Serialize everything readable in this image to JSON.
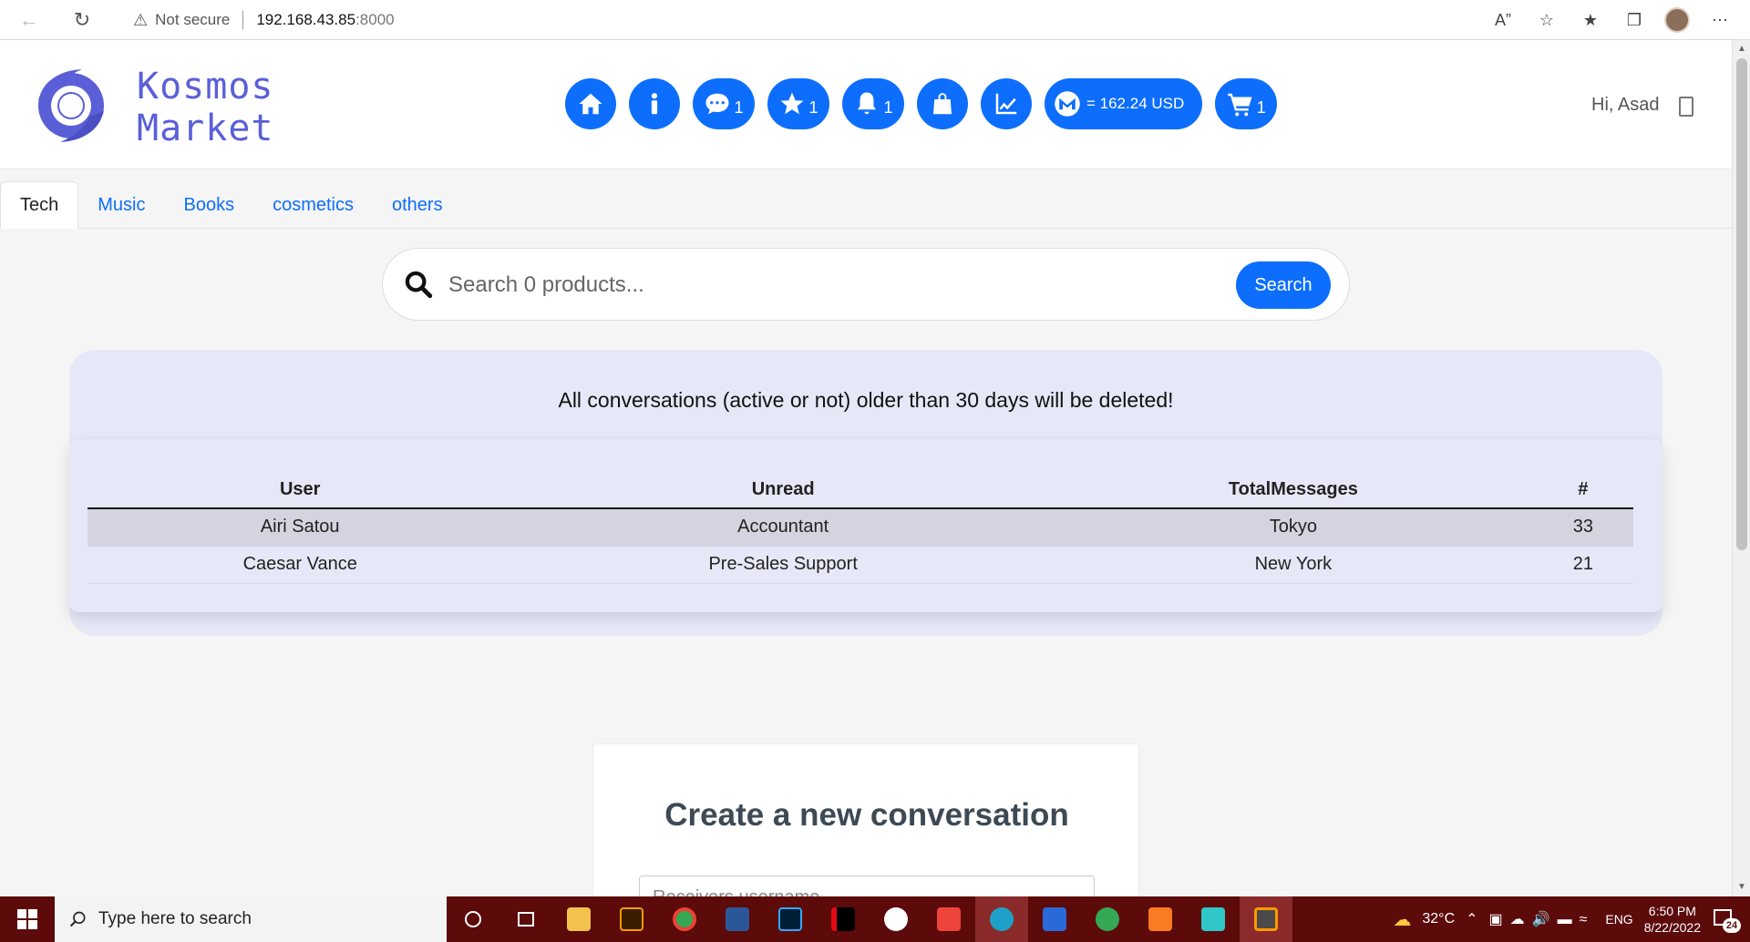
{
  "browser": {
    "security_label": "Not secure",
    "url_host": "192.168.43.85",
    "url_port": ":8000"
  },
  "header": {
    "brand_line1": "Kosmos",
    "brand_line2": "Market",
    "messages_count": "1",
    "favorites_count": "1",
    "notifications_count": "1",
    "balance": "= 162.24 USD",
    "cart_count": "1",
    "greeting": "Hi, Asad"
  },
  "tabs": [
    "Tech",
    "Music",
    "Books",
    "cosmetics",
    "others"
  ],
  "search": {
    "placeholder": "Search 0 products...",
    "button_label": "Search"
  },
  "conversations": {
    "notice": "All conversations (active or not) older than 30 days will be deleted!",
    "columns": [
      "User",
      "Unread",
      "TotalMessages",
      "#"
    ],
    "rows": [
      [
        "Airi Satou",
        "Accountant",
        "Tokyo",
        "33"
      ],
      [
        "Caesar Vance",
        "Pre-Sales Support",
        "New York",
        "21"
      ]
    ]
  },
  "create": {
    "title": "Create a new conversation",
    "receiver_placeholder": "Receivers username"
  },
  "taskbar": {
    "search_placeholder": "Type here to search",
    "temperature": "32°C",
    "language": "ENG",
    "time": "6:50 PM",
    "date": "8/22/2022",
    "notification_count": "24"
  },
  "colors": {
    "primary": "#0d6efd",
    "brand": "#5a5fd8",
    "card_bg": "#e6e8f7",
    "taskbar": "#5c0a0a"
  }
}
